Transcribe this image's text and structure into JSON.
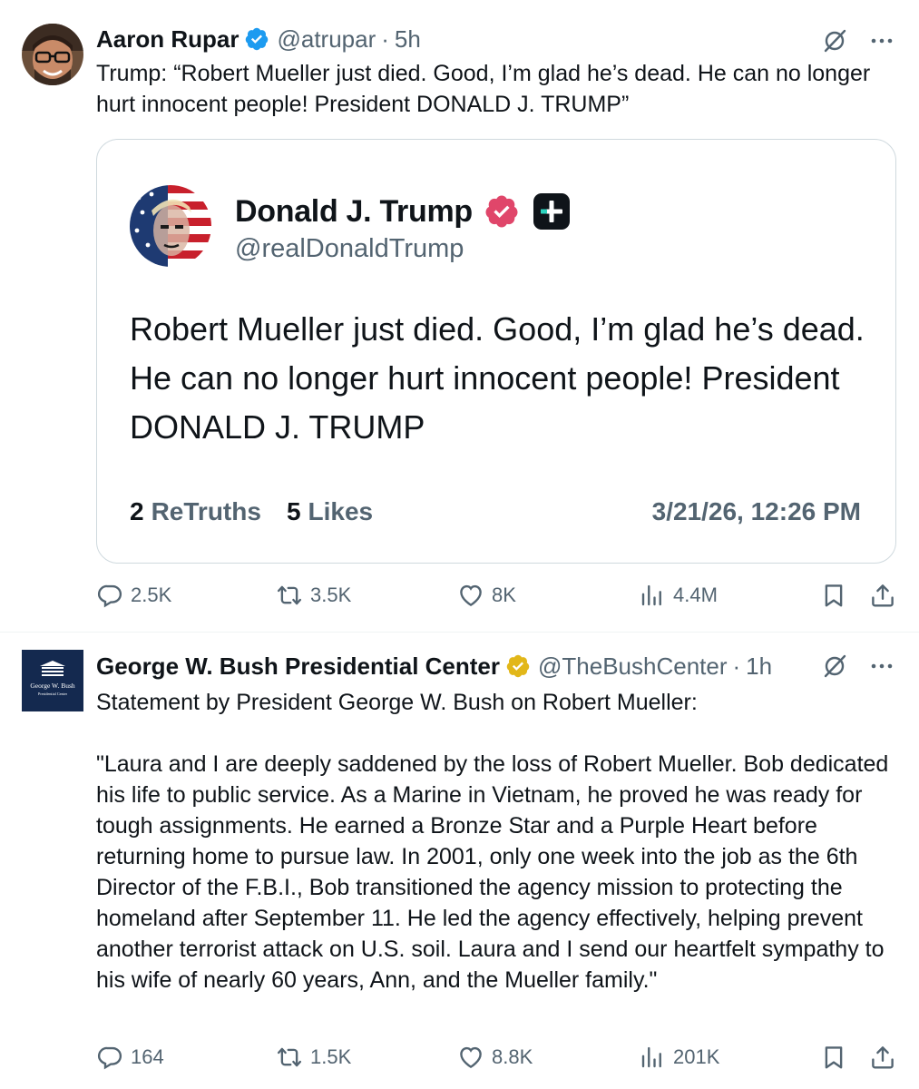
{
  "tweets": [
    {
      "author": {
        "name": "Aaron Rupar",
        "handle": "@atrupar",
        "time": "5h",
        "verified_badge_color": "#1d9bf0"
      },
      "text": "Trump: “Robert Mueller just died. Good, I’m glad he’s dead. He can no longer hurt innocent people! President DONALD J. TRUMP”",
      "quote": {
        "name": "Donald J. Trump",
        "handle": "@realDonaldTrump",
        "text": "Robert Mueller just died. Good, I’m glad he’s dead. He can no longer hurt innocent people! President DONALD J. TRUMP",
        "retruths_count": "2",
        "retruths_label": "ReTruths",
        "likes_count": "5",
        "likes_label": "Likes",
        "date": "3/21/26, 12:26 PM",
        "verified_badge_color": "#e0466a"
      },
      "stats": {
        "replies": "2.5K",
        "reposts": "3.5K",
        "likes": "8K",
        "views": "4.4M"
      }
    },
    {
      "author": {
        "name": "George W. Bush Presidential Center",
        "handle": "@TheBushCenter",
        "time": "1h",
        "verified_badge_color": "#e2b719"
      },
      "text": "Statement by President George W. Bush on Robert Mueller:\n\n\"Laura and I are deeply saddened by the loss of Robert Mueller. Bob dedicated his life to public service. As a Marine in Vietnam, he proved he was ready for tough assignments. He earned a Bronze Star and a Purple Heart before returning home to pursue law. In 2001, only one week into the job as the 6th Director of the F.B.I., Bob transitioned the agency mission to protecting the homeland after September 11. He led the agency effectively, helping prevent another terrorist attack on U.S. soil. Laura and I send our heartfelt sympathy to his wife of nearly 60 years, Ann, and the Mueller family.\"",
      "logo_text": [
        "George W. Bush",
        "Presidential Center"
      ],
      "stats": {
        "replies": "164",
        "reposts": "1.5K",
        "likes": "8.8K",
        "views": "201K"
      }
    }
  ],
  "icons": [
    "grok-icon",
    "more-icon",
    "reply-icon",
    "repost-icon",
    "like-icon",
    "views-icon",
    "bookmark-icon",
    "share-icon",
    "verified-badge-icon",
    "plus-icon"
  ],
  "colors": {
    "text": "#0f1419",
    "secondary": "#536471",
    "border": "#cfd9de"
  }
}
